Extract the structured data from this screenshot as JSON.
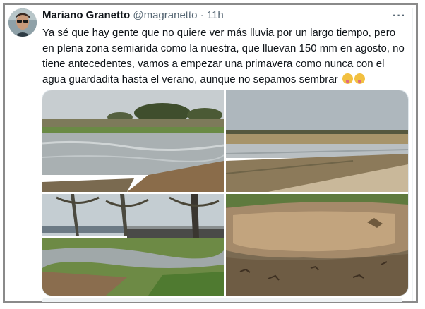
{
  "tweet": {
    "author_name": "Mariano Granetto",
    "handle": "@magranetto",
    "separator": "·",
    "time": "11h",
    "more_icon": "more-horizontal-icon",
    "text": "Ya sé que hay gente que no quiere ver más lluvia por un largo tiempo, pero en plena zona semiarida como la nuestra, que lluevan 150 mm en agosto, no tiene antecedentes, vamos a empezar una primavera como nunca con el agua guardadita hasta el verano, aunque no sepamos sembrar",
    "emojis": [
      "squinting-face-with-tongue",
      "squinting-face-with-tongue"
    ],
    "photos": [
      {
        "name": "flooded-field-with-trees"
      },
      {
        "name": "flooded-road-and-field"
      },
      {
        "name": "flooded-yard-with-shed"
      },
      {
        "name": "muddy-puddle-closeup"
      }
    ]
  },
  "colors": {
    "text": "#0f1419",
    "secondary": "#536471",
    "border": "#8a8a8a"
  }
}
